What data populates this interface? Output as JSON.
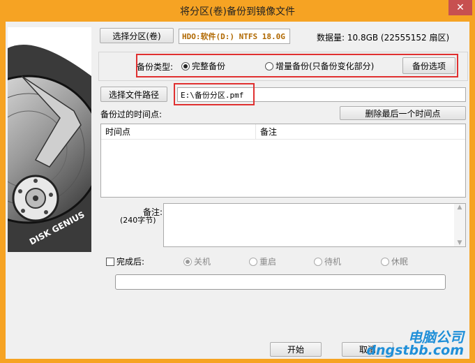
{
  "window": {
    "title": "将分区(卷)备份到镜像文件",
    "close_glyph": "✕"
  },
  "logo_text": "DISK GENIUS",
  "partition": {
    "select_button": "选择分区(卷)",
    "value": "HDO:软件(D:) NTFS 18.0G",
    "data_size": "数据量: 10.8GB (22555152 扇区)"
  },
  "backup_type": {
    "label": "备份类型:",
    "full_label": "完整备份",
    "full_selected": true,
    "incremental_label": "增量备份(只备份变化部分)",
    "incremental_selected": false,
    "options_button": "备份选项"
  },
  "file_path": {
    "select_button": "选择文件路径",
    "value": "E:\\备份分区.pmf"
  },
  "timepoints": {
    "label": "备份过的时间点:",
    "delete_button": "删除最后一个时间点",
    "columns": [
      "时间点",
      "备注"
    ]
  },
  "notes": {
    "label": "备注:",
    "sublabel": "(240字节)",
    "value": ""
  },
  "after_completion": {
    "label": "完成后:",
    "checked": false,
    "options": [
      {
        "label": "关机",
        "selected": true
      },
      {
        "label": "重启",
        "selected": false
      },
      {
        "label": "待机",
        "selected": false
      },
      {
        "label": "休眠",
        "selected": false
      }
    ]
  },
  "progress": {
    "value": 0
  },
  "footer": {
    "start_button": "开始",
    "cancel_button": "取消"
  },
  "watermark": {
    "cn": "电脑公司",
    "en": "dngstbb.com"
  },
  "colors": {
    "frame": "#f6a323",
    "highlight": "#e03030",
    "watermark": "#1f8fd8"
  }
}
